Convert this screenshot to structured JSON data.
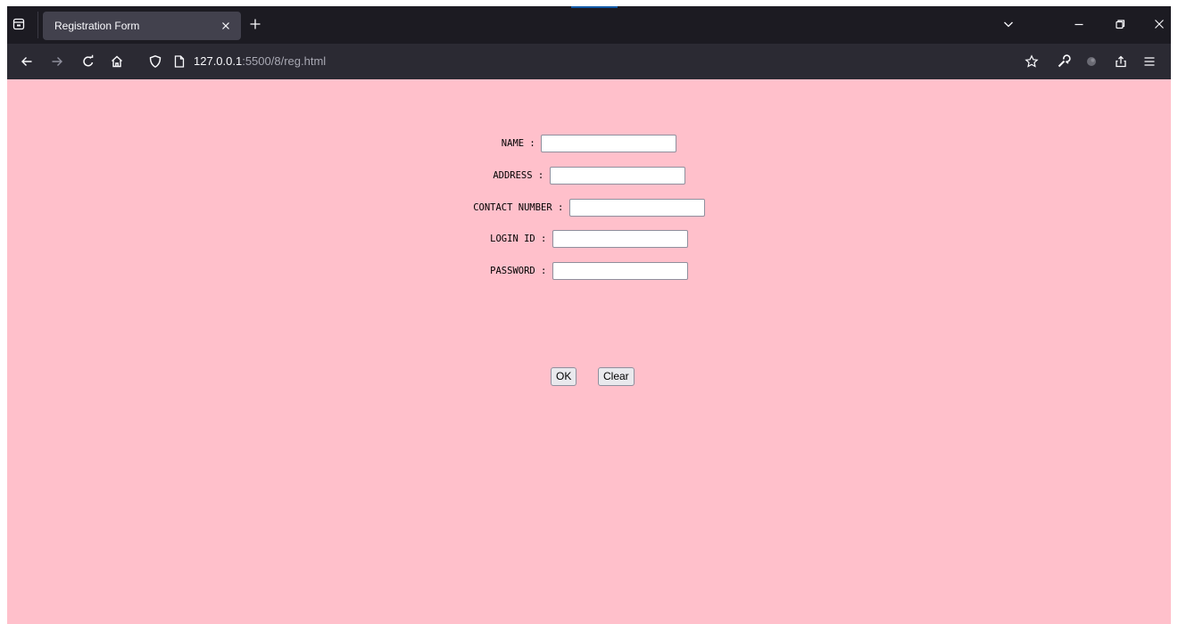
{
  "browser": {
    "tab": {
      "title": "Registration Form"
    },
    "url": {
      "host": "127.0.0.1",
      "path": ":5500/8/reg.html"
    }
  },
  "form": {
    "fields": [
      {
        "label": "NAME :",
        "value": ""
      },
      {
        "label": "ADDRESS :",
        "value": ""
      },
      {
        "label": "CONTACT NUMBER :",
        "value": ""
      },
      {
        "label": "LOGIN ID :",
        "value": ""
      },
      {
        "label": "PASSWORD :",
        "value": ""
      }
    ],
    "ok_label": "OK",
    "clear_label": "Clear"
  },
  "colors": {
    "page_background": "#ffc0cb",
    "chrome_dark": "#1c1b22",
    "tab_active": "#42414d",
    "toolbar": "#2b2a33"
  },
  "icons": {
    "tab_list": "tab-list-icon",
    "close_tab": "close-icon",
    "new_tab": "plus-icon",
    "list_all_tabs": "chevron-down-icon",
    "minimize": "minimize-icon",
    "restore": "restore-icon",
    "close_window": "close-icon",
    "back": "back-arrow-icon",
    "forward": "forward-arrow-icon",
    "reload": "reload-icon",
    "home": "home-icon",
    "tracking_protection": "shield-icon",
    "page_info": "page-icon",
    "bookmark": "star-icon",
    "tools": "wrench-icon",
    "extension": "extension-icon",
    "share": "share-icon",
    "menu": "hamburger-menu-icon"
  }
}
